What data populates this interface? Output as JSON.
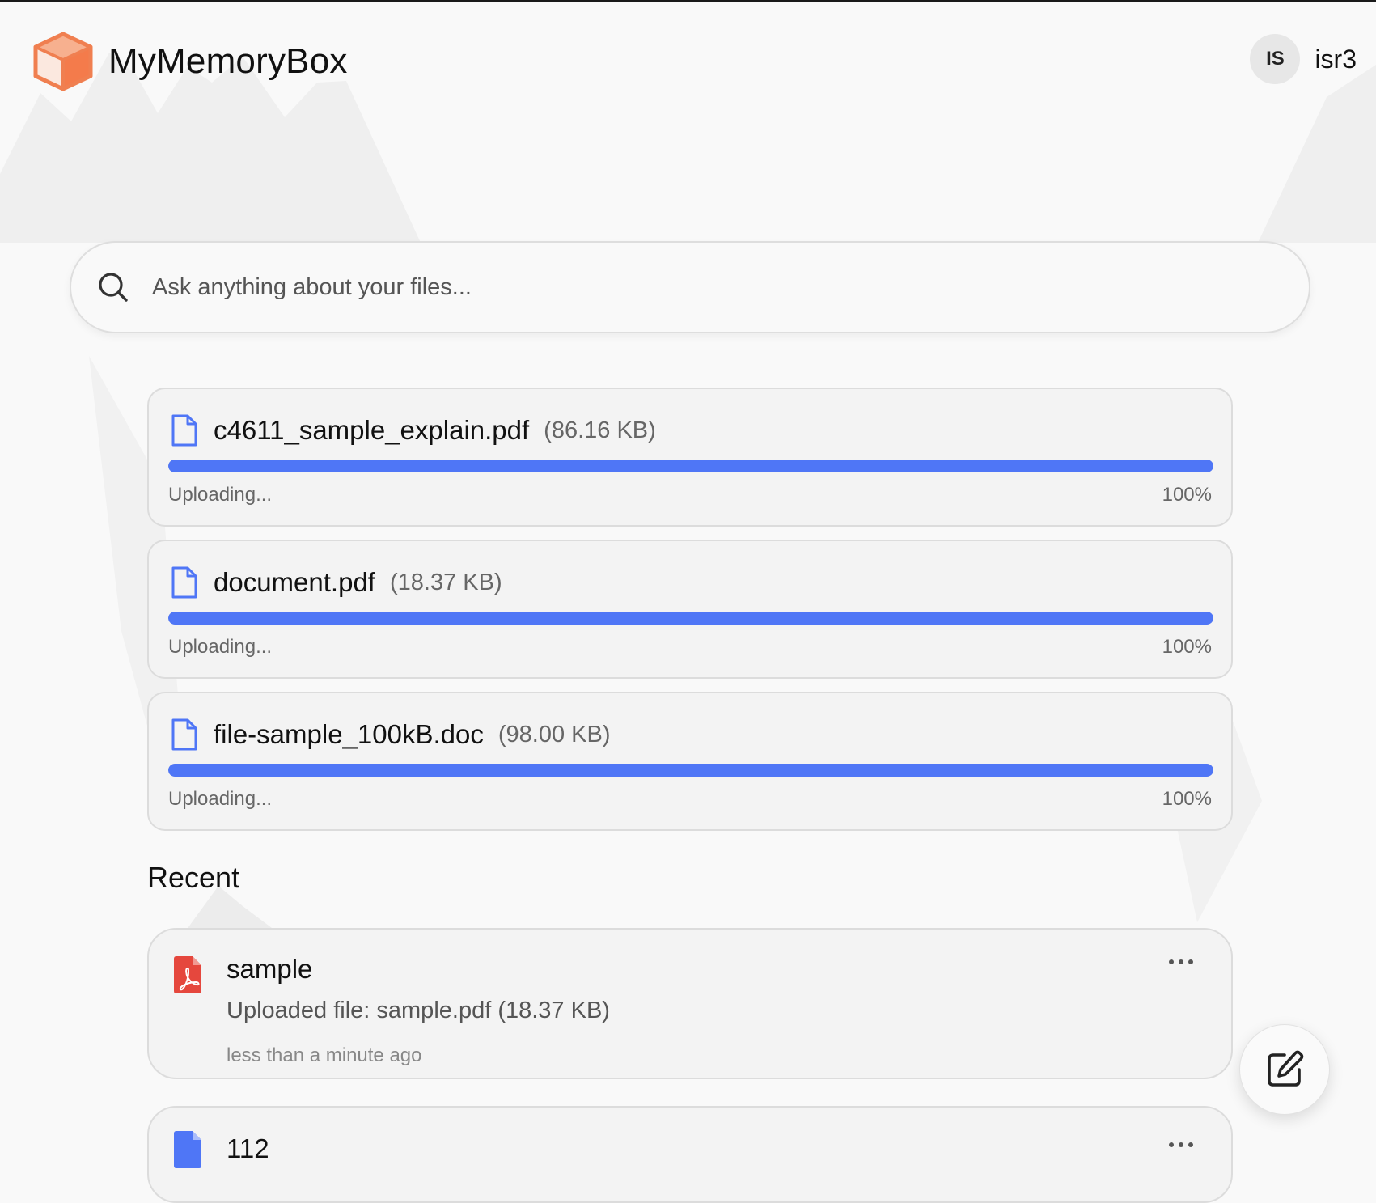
{
  "app": {
    "name": "MyMemoryBox",
    "logo_icon": "cube-logo-icon",
    "accent_color": "#f07f50"
  },
  "user": {
    "initials": "IS",
    "username": "isr3"
  },
  "search": {
    "placeholder": "Ask anything about your files...",
    "value": "",
    "icon": "search-icon"
  },
  "uploads": [
    {
      "name": "c4611_sample_explain.pdf",
      "size": "(86.16 KB)",
      "status": "Uploading...",
      "progress_label": "100%",
      "progress": 1.0,
      "icon": "document-icon"
    },
    {
      "name": "document.pdf",
      "size": "(18.37 KB)",
      "status": "Uploading...",
      "progress_label": "100%",
      "progress": 1.0,
      "icon": "document-icon"
    },
    {
      "name": "file-sample_100kB.doc",
      "size": "(98.00 KB)",
      "status": "Uploading...",
      "progress_label": "100%",
      "progress": 1.0,
      "icon": "document-icon"
    }
  ],
  "recent": {
    "title": "Recent",
    "items": [
      {
        "name": "sample",
        "description": "Uploaded file: sample.pdf (18.37 KB)",
        "time": "less than a minute ago",
        "icon": "pdf-file-icon",
        "icon_color": "#e5473d"
      },
      {
        "name": "112",
        "icon": "blue-file-icon",
        "icon_color": "#4f76f6"
      }
    ]
  },
  "fab": {
    "icon": "edit-note-icon"
  },
  "colors": {
    "progress": "#4f76f6",
    "background": "#f9f9f9",
    "card": "#f3f3f3"
  }
}
